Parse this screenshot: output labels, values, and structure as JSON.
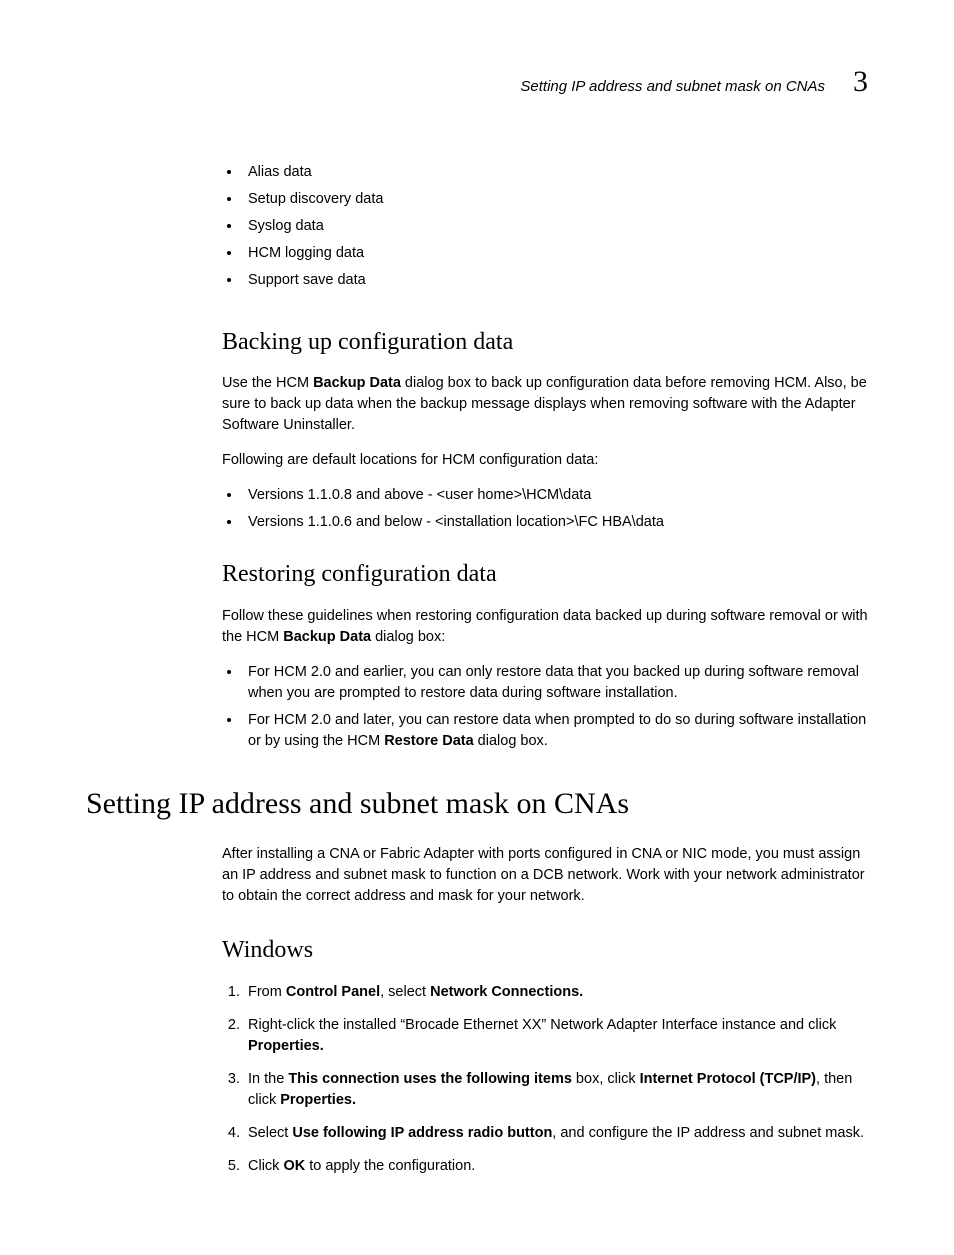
{
  "header": {
    "text": "Setting IP address and subnet mask on CNAs",
    "chapter": "3"
  },
  "intro_bullets": [
    "Alias data",
    "Setup discovery data",
    "Syslog data",
    "HCM logging data",
    "Support save data"
  ],
  "backing": {
    "title": "Backing up configuration data",
    "para1_segments": [
      {
        "t": "Use the HCM ",
        "b": false
      },
      {
        "t": "Backup Data",
        "b": true
      },
      {
        "t": " dialog box to back up configuration data before removing HCM. Also, be sure to back up data when the backup message displays when removing software with the Adapter Software Uninstaller.",
        "b": false
      }
    ],
    "para2": "Following are default locations for HCM configuration data:",
    "bullets": [
      "Versions 1.1.0.8 and above - <user home>\\HCM\\data",
      "Versions 1.1.0.6 and below - <installation location>\\FC HBA\\data"
    ]
  },
  "restoring": {
    "title": "Restoring configuration data",
    "para1_segments": [
      {
        "t": "Follow these guidelines when restoring configuration data backed up during software removal or with the HCM ",
        "b": false
      },
      {
        "t": "Backup Data",
        "b": true
      },
      {
        "t": " dialog box:",
        "b": false
      }
    ],
    "bullets": [
      {
        "segments": [
          {
            "t": "For HCM 2.0 and earlier, you can only restore data that you backed up during software removal when you are prompted to restore data during software installation.",
            "b": false
          }
        ]
      },
      {
        "segments": [
          {
            "t": "For HCM 2.0 and later, you can restore data when prompted to do so during software installation or by using the HCM ",
            "b": false
          },
          {
            "t": "Restore Data",
            "b": true
          },
          {
            "t": " dialog box.",
            "b": false
          }
        ]
      }
    ]
  },
  "setting": {
    "title": "Setting IP address and subnet mask on CNAs",
    "para": "After installing a CNA or Fabric Adapter with ports configured in CNA or NIC mode, you must assign an IP address and subnet mask to function on a DCB network. Work with your network administrator to obtain the correct address and mask for your network."
  },
  "windows": {
    "title": "Windows",
    "steps": [
      {
        "segments": [
          {
            "t": "From ",
            "b": false
          },
          {
            "t": "Control Panel",
            "b": true
          },
          {
            "t": ", select ",
            "b": false
          },
          {
            "t": "Network Connections.",
            "b": true
          }
        ]
      },
      {
        "segments": [
          {
            "t": "Right-click the installed “Brocade Ethernet XX” Network Adapter Interface instance and click ",
            "b": false
          },
          {
            "t": "Properties.",
            "b": true
          }
        ]
      },
      {
        "segments": [
          {
            "t": "In the ",
            "b": false
          },
          {
            "t": "This connection uses the following items",
            "b": true
          },
          {
            "t": " box, click ",
            "b": false
          },
          {
            "t": "Internet Protocol (TCP/IP)",
            "b": true
          },
          {
            "t": ", then click ",
            "b": false
          },
          {
            "t": "Properties.",
            "b": true
          }
        ]
      },
      {
        "segments": [
          {
            "t": "Select ",
            "b": false
          },
          {
            "t": "Use following IP address radio button",
            "b": true
          },
          {
            "t": ", and configure the IP address and subnet mask.",
            "b": false
          }
        ]
      },
      {
        "segments": [
          {
            "t": "Click ",
            "b": false
          },
          {
            "t": "OK",
            "b": true
          },
          {
            "t": " to apply the configuration.",
            "b": false
          }
        ]
      }
    ]
  }
}
